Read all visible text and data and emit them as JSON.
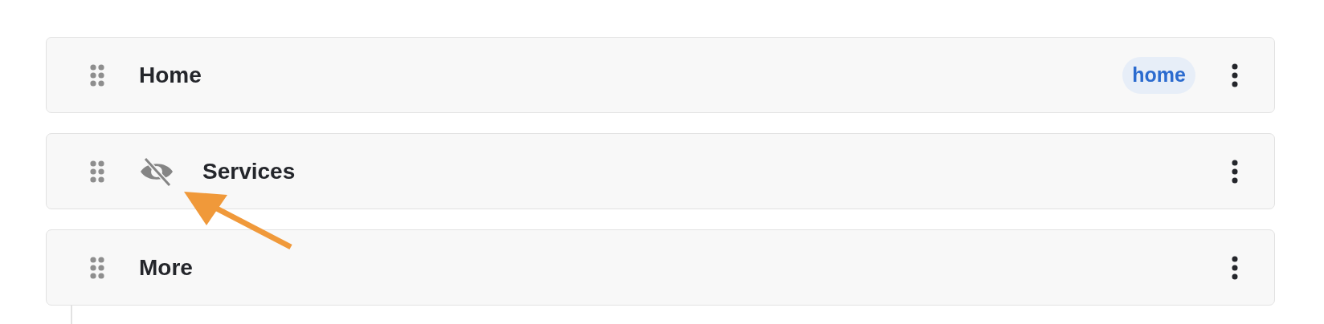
{
  "menu_items": [
    {
      "label": "Home",
      "hidden": false,
      "badge": "home"
    },
    {
      "label": "Services",
      "hidden": true
    },
    {
      "label": "More",
      "hidden": false
    }
  ]
}
